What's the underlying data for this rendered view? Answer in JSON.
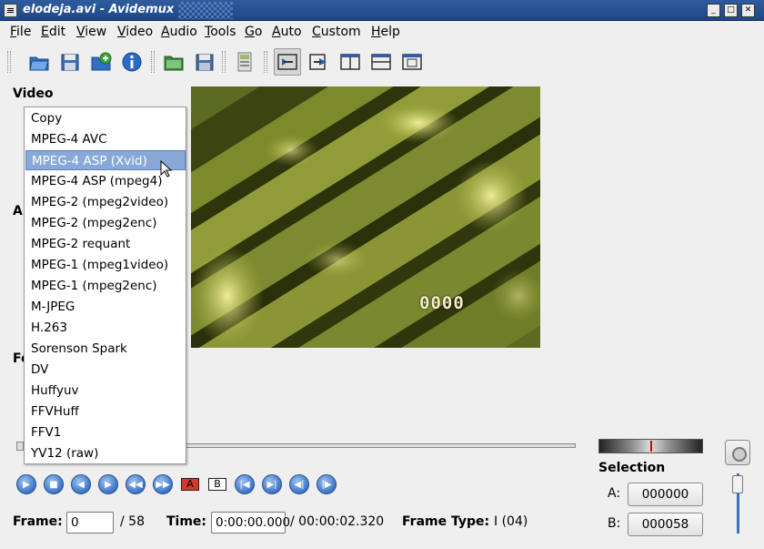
{
  "window": {
    "title": "elodeja.avi - Avidemux"
  },
  "menu": [
    "File",
    "Edit",
    "View",
    "Video",
    "Audio",
    "Tools",
    "Go",
    "Auto",
    "Custom",
    "Help"
  ],
  "menu_underline": [
    "F",
    "E",
    "V",
    "V",
    "A",
    "T",
    "G",
    "A",
    "C",
    "H"
  ],
  "toolbar": {
    "icons": [
      "open-icon",
      "save-icon",
      "open-append-icon",
      "info-icon",
      "open-folder-icon",
      "save-project-icon",
      "calculator-icon",
      "preview-input-icon",
      "preview-output-icon",
      "side-by-side-icon",
      "top-bottom-icon",
      "preview-separate-icon"
    ]
  },
  "left": {
    "video_label": "Video",
    "audio_label_partial": "Au",
    "format_label_partial": "Fo"
  },
  "codec_dropdown": {
    "items": [
      "Copy",
      "MPEG-4 AVC",
      "MPEG-4 ASP (Xvid)",
      "MPEG-4 ASP (mpeg4)",
      "MPEG-2 (mpeg2video)",
      "MPEG-2 (mpeg2enc)",
      "MPEG-2 requant",
      "MPEG-1 (mpeg1video)",
      "MPEG-1 (mpeg2enc)",
      "M-JPEG",
      "H.263",
      "Sorenson Spark",
      "DV",
      "Huffyuv",
      "FFVHuff",
      "FFV1",
      "YV12 (raw)"
    ],
    "selected_index": 2
  },
  "preview": {
    "overlay_text": "0000"
  },
  "playback": {
    "buttons": [
      "play-icon",
      "stop-icon",
      "previous-frame-icon",
      "next-frame-icon",
      "previous-keyframe-icon",
      "next-keyframe-icon",
      "mark-a-icon",
      "mark-b-icon",
      "goto-start-icon",
      "goto-end-icon",
      "previous-black-icon",
      "next-black-icon"
    ],
    "mark_a": "A",
    "mark_b": "B"
  },
  "status": {
    "frame_label": "Frame:",
    "frame_value": "0",
    "frame_total": "/ 58",
    "time_label": "Time:",
    "time_value": "0:00:00.000",
    "time_total": "/ 00:00:02.320",
    "frame_type_label": "Frame Type:",
    "frame_type_value": "I (04)"
  },
  "selection": {
    "title": "Selection",
    "a_label": "A:",
    "a_value": "000000",
    "b_label": "B:",
    "b_value": "000058"
  },
  "colors": {
    "titlebar": "#2f5c9e",
    "selection": "#88a9d8",
    "accent_blue": "#3a74c9"
  }
}
